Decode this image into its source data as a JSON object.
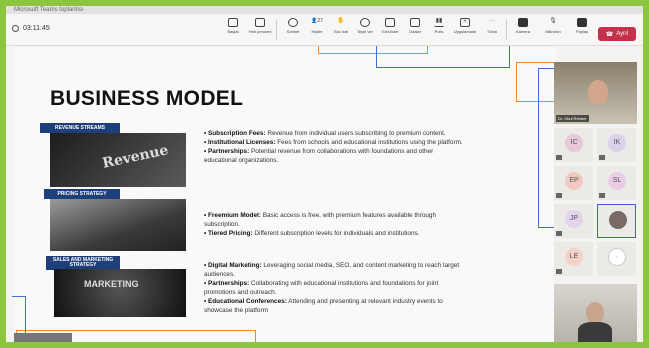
{
  "window": {
    "title": "Microsoft Teams toplantısı"
  },
  "timer": "03:11:45",
  "toolbar": {
    "items": [
      {
        "label": "Başlat",
        "icon": "present-icon"
      },
      {
        "label": "Yeni pencere",
        "icon": "new-window-icon"
      },
      {
        "label": "Sohbet",
        "icon": "chat-icon"
      },
      {
        "label": "Kişiler",
        "icon": "people-icon",
        "badge": "27"
      },
      {
        "label": "Söz iste",
        "icon": "raise-hand-icon"
      },
      {
        "label": "Tepki ver",
        "icon": "react-icon"
      },
      {
        "label": "Görünüm",
        "icon": "view-icon"
      },
      {
        "label": "Odalar",
        "icon": "rooms-icon"
      },
      {
        "label": "Polls",
        "icon": "polls-icon"
      },
      {
        "label": "Uygulamalar",
        "icon": "apps-icon"
      },
      {
        "label": "Tümü",
        "icon": "more-icon"
      },
      {
        "label": "Kamera",
        "icon": "camera-icon"
      },
      {
        "label": "Mikrofon",
        "icon": "mic-icon"
      },
      {
        "label": "Paylaş",
        "icon": "share-icon"
      }
    ],
    "leave_label": "Ayrıl"
  },
  "slide": {
    "title": "BUSINESS MODEL",
    "sections": [
      {
        "label": "REVENUE STREAMS",
        "image_word": "Revenue",
        "bullets": [
          {
            "bold": "• Subscription Fees:",
            "text": " Revenue from individual users subscribing to premium content."
          },
          {
            "bold": "• Institutional Licenses:",
            "text": " Fees from schools and educational institutions using the platform."
          },
          {
            "bold": "• Partnerships:",
            "text": " Potential revenue from collaborations with foundations and other educational organizations."
          }
        ]
      },
      {
        "label": "PRICING STRATEGY",
        "image_word": "",
        "bullets": [
          {
            "bold": "• Freemium Model:",
            "text": " Basic access is free, with premium features available through subscription."
          },
          {
            "bold": "• Tiered Pricing:",
            "text": " Different subscription levels for individuals and institutions."
          }
        ]
      },
      {
        "label": "SALES AND MARKETING STRATEGY",
        "image_word": "MARKETING",
        "bullets": [
          {
            "bold": "• Digital Marketing:",
            "text": " Leveraging social media, SEO, and content marketing to reach target audiences."
          },
          {
            "bold": "• Partnerships:",
            "text": " Collaborating with educational institutions and foundations for joint promotions and outreach."
          },
          {
            "bold": "• Educational Conferences:",
            "text": " Attending and presenting at relevant industry events to showcase the platform"
          }
        ]
      }
    ]
  },
  "participants": {
    "presenter_name": "Dr. Okul Rehber",
    "tiles": [
      {
        "initials": "IC",
        "color": "#e6c8d8"
      },
      {
        "initials": "IK",
        "color": "#d9d2e8"
      },
      {
        "initials": "EP",
        "color": "#f2c9c0"
      },
      {
        "initials": "SL",
        "color": "#e9cde6"
      },
      {
        "initials": "JP",
        "color": "#e4d3ec"
      },
      {
        "initials": "",
        "color": "#7a6a66"
      },
      {
        "initials": "LE",
        "color": "#f4d2c8"
      },
      {
        "initials": "·",
        "color": "#ffffff"
      }
    ]
  }
}
